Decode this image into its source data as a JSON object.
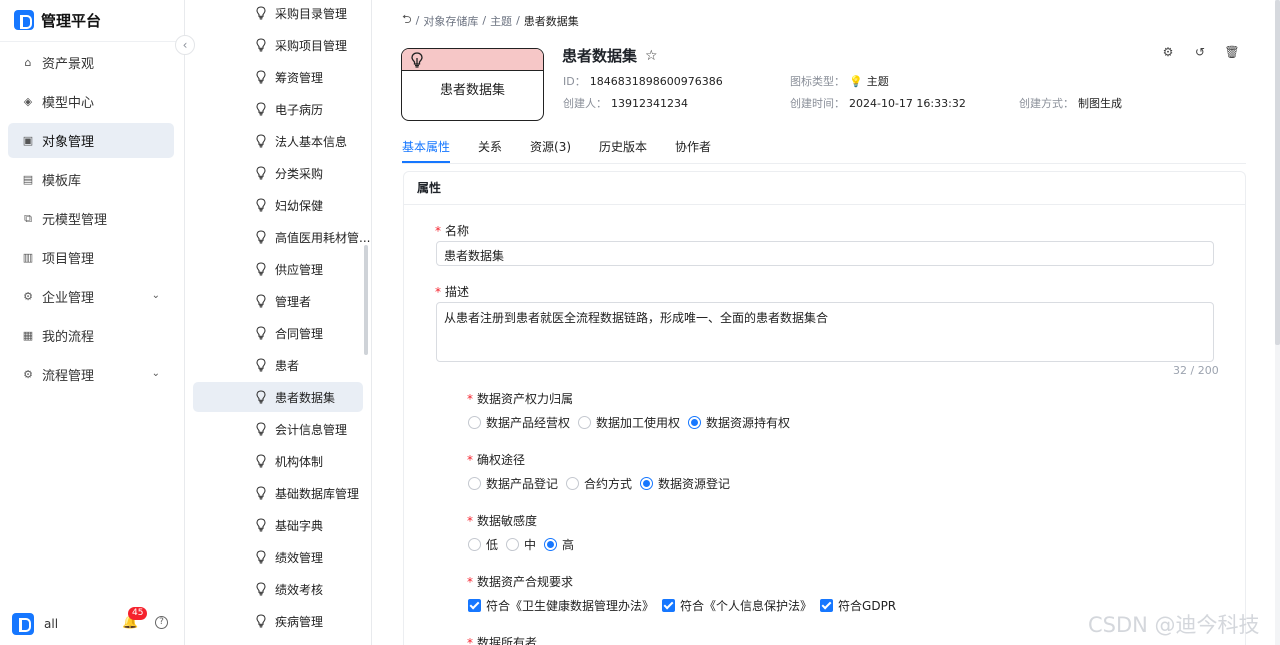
{
  "app": {
    "title": "管理平台"
  },
  "sidebar": {
    "items": [
      {
        "label": "资产景观",
        "icon": "bank-icon"
      },
      {
        "label": "模型中心",
        "icon": "layers-icon"
      },
      {
        "label": "对象管理",
        "icon": "object-icon",
        "active": true
      },
      {
        "label": "模板库",
        "icon": "template-icon"
      },
      {
        "label": "元模型管理",
        "icon": "metamodel-icon"
      },
      {
        "label": "项目管理",
        "icon": "project-icon"
      },
      {
        "label": "企业管理",
        "icon": "enterprise-icon",
        "expandable": true
      },
      {
        "label": "我的流程",
        "icon": "process-icon"
      },
      {
        "label": "流程管理",
        "icon": "flow-icon",
        "expandable": true
      }
    ],
    "user": {
      "name": "all",
      "notifications": "45"
    }
  },
  "objects": [
    "采购目录管理",
    "采购项目管理",
    "筹资管理",
    "电子病历",
    "法人基本信息",
    "分类采购",
    "妇幼保健",
    "高值医用耗材管...",
    "供应管理",
    "管理者",
    "合同管理",
    "患者",
    "患者数据集",
    "会计信息管理",
    "机构体制",
    "基础数据库管理",
    "基础字典",
    "绩效管理",
    "绩效考核",
    "疾病管理"
  ],
  "active_object": "患者数据集",
  "breadcrumb": {
    "items": [
      "对象存储库",
      "主题",
      "患者数据集"
    ]
  },
  "card": {
    "title": "患者数据集",
    "header_color": "#f6c7c7"
  },
  "detail": {
    "title": "患者数据集",
    "id_label": "ID：",
    "id": "1846831898600976386",
    "creator_label": "创建人：",
    "creator": "13912341234",
    "icon_type_label": "图标类型：",
    "icon_type": "主题",
    "created_time_label": "创建时间：",
    "created_time": "2024-10-17 16:33:32",
    "create_method_label": "创建方式：",
    "create_method": "制图生成"
  },
  "tabs": [
    "基本属性",
    "关系",
    "资源(3)",
    "历史版本",
    "协作者"
  ],
  "panel": {
    "title": "属性",
    "name_label": "名称",
    "name_value": "患者数据集",
    "desc_label": "描述",
    "desc_value": "从患者注册到患者就医全流程数据链路，形成唯一、全面的患者数据集合",
    "desc_count": "32 / 200",
    "ownership": {
      "label": "数据资产权力归属",
      "options": [
        "数据产品经营权",
        "数据加工使用权",
        "数据资源持有权"
      ],
      "selected": "数据资源持有权"
    },
    "confirm": {
      "label": "确权途径",
      "options": [
        "数据产品登记",
        "合约方式",
        "数据资源登记"
      ],
      "selected": "数据资源登记"
    },
    "sensitivity": {
      "label": "数据敏感度",
      "options": [
        "低",
        "中",
        "高"
      ],
      "selected": "高"
    },
    "compliance": {
      "label": "数据资产合规要求",
      "options": [
        "符合《卫生健康数据管理办法》",
        "符合《个人信息保护法》",
        "符合GDPR"
      ]
    },
    "owner_label": "数据所有者"
  },
  "watermark": "CSDN @迪今科技",
  "colors": {
    "accent": "#1677ff",
    "required": "#f5222d"
  }
}
